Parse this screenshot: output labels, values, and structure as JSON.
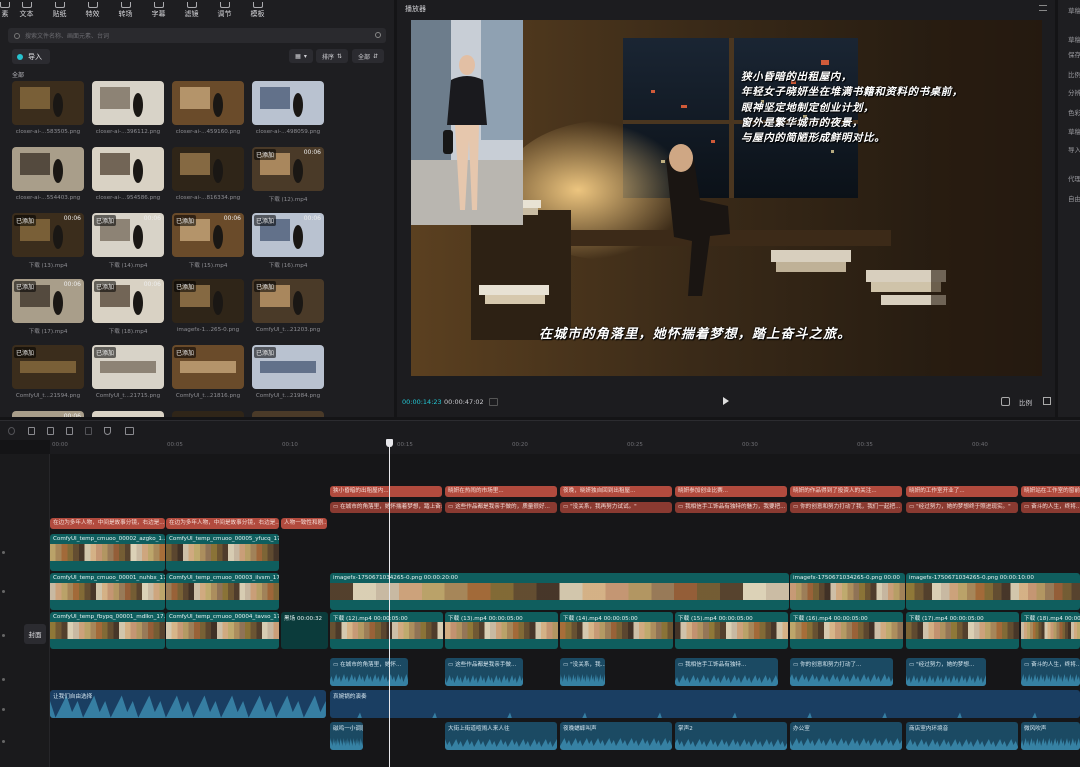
{
  "toolbar": {
    "items": [
      {
        "label": "素",
        "icon": "media-icon"
      },
      {
        "label": "文本",
        "icon": "text-icon"
      },
      {
        "label": "贴纸",
        "icon": "sticker-icon"
      },
      {
        "label": "特效",
        "icon": "effects-icon"
      },
      {
        "label": "转场",
        "icon": "transition-icon"
      },
      {
        "label": "字幕",
        "icon": "subtitle-icon"
      },
      {
        "label": "滤镜",
        "icon": "filter-icon"
      },
      {
        "label": "调节",
        "icon": "adjust-icon"
      },
      {
        "label": "模板",
        "icon": "template-icon"
      }
    ]
  },
  "media": {
    "search_placeholder": "搜索文件名称、画面元素、台词",
    "import_label": "导入",
    "sort_label": "排序",
    "filter_label": "全部",
    "all_label": "全部",
    "items": [
      {
        "name": "closer-ai-...583505.png",
        "badge": "",
        "duration": ""
      },
      {
        "name": "closer-ai-...396112.png",
        "badge": "",
        "duration": ""
      },
      {
        "name": "closer-ai-...459160.png",
        "badge": "",
        "duration": ""
      },
      {
        "name": "closer-ai-...498059.png",
        "badge": "",
        "duration": ""
      },
      {
        "name": "closer-ai-...554403.png",
        "badge": "",
        "duration": ""
      },
      {
        "name": "closer-ai-...954586.png",
        "badge": "",
        "duration": ""
      },
      {
        "name": "closer-ai-...816334.png",
        "badge": "",
        "duration": ""
      },
      {
        "name": "下载 (12).mp4",
        "badge": "已添加",
        "duration": "00:06"
      },
      {
        "name": "下载 (13).mp4",
        "badge": "已添加",
        "duration": "00:06"
      },
      {
        "name": "下载 (14).mp4",
        "badge": "已添加",
        "duration": "00:06"
      },
      {
        "name": "下载 (15).mp4",
        "badge": "已添加",
        "duration": "00:06"
      },
      {
        "name": "下载 (16).mp4",
        "badge": "已添加",
        "duration": "00:06"
      },
      {
        "name": "下载 (17).mp4",
        "badge": "已添加",
        "duration": "00:06"
      },
      {
        "name": "下载 (18).mp4",
        "badge": "已添加",
        "duration": "00:06"
      },
      {
        "name": "imagefx-1...265-0.png",
        "badge": "已添加",
        "duration": ""
      },
      {
        "name": "ComfyUI_t...21203.png",
        "badge": "已添加",
        "duration": ""
      },
      {
        "name": "ComfyUI_t...21594.png",
        "badge": "已添加",
        "duration": ""
      },
      {
        "name": "ComfyUI_t...21715.png",
        "badge": "已添加",
        "duration": ""
      },
      {
        "name": "ComfyUI_t...21816.png",
        "badge": "已添加",
        "duration": ""
      },
      {
        "name": "ComfyUI_t...21984.png",
        "badge": "已添加",
        "duration": ""
      }
    ],
    "partial_duration": "00:06"
  },
  "player": {
    "title": "播放器",
    "caption_top": [
      "狭小昏暗的出租屋内，",
      "年轻女子晓妍坐在堆满书籍和资料的书桌前，",
      "眼神坚定地制定创业计划，",
      "窗外是繁华城市的夜景，",
      "与屋内的简陋形成鲜明对比。"
    ],
    "caption_bottom": "在城市的角落里，她怀揣着梦想，踏上奋斗之旅。",
    "time_current": "00:00:14:23",
    "time_total": "00:00:47:02",
    "ratio_label": "比例"
  },
  "right_panel": {
    "labels": [
      "草稿",
      "草稿",
      "保存",
      "比例",
      "分辨",
      "色彩",
      "草稿",
      "导入",
      "代理",
      "自由"
    ]
  },
  "timeline": {
    "ruler": [
      "00:00",
      "00:05",
      "00:10",
      "00:15",
      "00:20",
      "00:25",
      "00:30",
      "00:35",
      "00:40"
    ],
    "cover_label": "封面",
    "text_clips": [
      "狭小昏暗的出租屋内...",
      "晓妍在热闹的市场里...",
      "夜晚，晓妍独自回到出租屋...",
      "晓妍参加创业比赛...",
      "晓妍的作品得到了投资人的关注...",
      "晓妍的工作室开业了...",
      "晓妍站在工作室的窗前..."
    ],
    "subtitle_clips": [
      "在城市的角落里，她怀揣着梦想，踏上奋斗...",
      "这些作品都是我亲手做的，质量很好...",
      "\"没关系，我再努力试试。\"",
      "我相信手工饰品有独特的魅力，我要把...",
      "你的创意和努力打动了我，我们一起把...",
      "\"经过努力，她的梦想终于照进现实。\"",
      "奋斗的人生，终将..."
    ],
    "subtitle_clips_2": [
      "在边为多年人物，中间是故事分镜，右边是...",
      "在边为多年人物，中间是故事分镜，右边是...",
      "人物一致性和剧..."
    ],
    "overlay_clips": [
      {
        "label": "ComfyUI_temp_cmuoo_00002_azgko_1..."
      },
      {
        "label": "ComfyUI_temp_cmuoo_00005_yfucq_17..."
      }
    ],
    "video_clips_upper": [
      {
        "label": "ComfyUI_temp_cmuoo_00001_nuhbx_17..."
      },
      {
        "label": "ComfyUI_temp_cmuoo_00003_ilvsm_17..."
      },
      {
        "label": "imagefx-1750671034265-0.png  00:00:20:00"
      },
      {
        "label": "imagefx-1750671034265-0.png  00:00"
      },
      {
        "label": "imagefx-1750671034265-0.png  00:00:10:00"
      }
    ],
    "video_clips_main": [
      {
        "label": "ComfyUI_temp_fbypq_00001_mdlkn_17..."
      },
      {
        "label": "ComfyUI_temp_cmuoo_00004_tavso_17..."
      },
      {
        "label": "黑场  00:00:32"
      },
      {
        "label": "下载 (12).mp4  00:00:05:00"
      },
      {
        "label": "下载 (13).mp4  00:00:05:00"
      },
      {
        "label": "下载 (14).mp4  00:00:05:00"
      },
      {
        "label": "下载 (15).mp4  00:00:05:00"
      },
      {
        "label": "下载 (16).mp4  00:00:05:00"
      },
      {
        "label": "下载 (17).mp4  00:00:05:00"
      },
      {
        "label": "下载 (18).mp4  00:00:05:00"
      }
    ],
    "voice_clips": [
      "在城市的角落里，她怀...",
      "这些作品都是我亲手做...",
      "\"没关系，我...",
      "我相信手工饰品有独特...",
      "你的创意和努力打动了...",
      "\"经过努力，她的梦想...",
      "奋斗的人生，终将..."
    ],
    "bgm_clips": [
      "让我们自由选择",
      "哀婉锅的演奏"
    ],
    "sfx_clips": [
      "磁鸣一小调剧",
      "大街上街道喧闹人来人往",
      "夜晚蟋蟀叫声",
      "掌声2",
      "办公室",
      "商店室内环境音",
      "微风吹声"
    ],
    "colors": {
      "text": "#b24b3e",
      "video": "#0f5e5e",
      "audio": "#1b4a63",
      "accent": "#23c7d4"
    }
  }
}
